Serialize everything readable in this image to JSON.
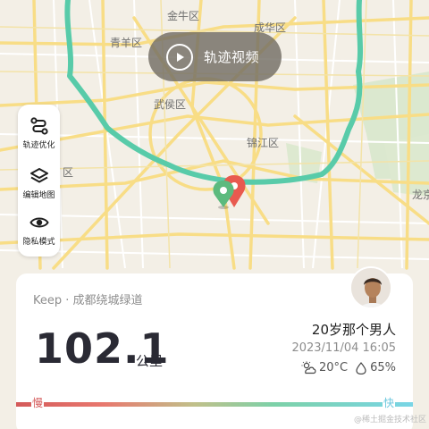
{
  "map": {
    "districts": {
      "jinniu": "金牛区",
      "chenghua": "成华区",
      "qingyang": "青羊区",
      "wuhou": "武侯区",
      "jinjiang": "锦江区",
      "shuangliu_partial": "区",
      "longquan_partial": "龙京"
    },
    "route_color": "#58cba9",
    "start_marker_color": "#5cba7e",
    "end_marker_color": "#e85a4f"
  },
  "video_button": {
    "label": "轨迹视频",
    "icon": "play-icon"
  },
  "toolbox": {
    "items": [
      {
        "label": "轨迹优化",
        "icon": "route-optimize-icon"
      },
      {
        "label": "编辑地图",
        "icon": "layers-icon"
      },
      {
        "label": "隐私模式",
        "icon": "eye-icon"
      }
    ]
  },
  "card": {
    "route_title": "Keep · 成都绕城绿道",
    "distance": "102.1",
    "unit": "公里",
    "username": "20岁那个男人",
    "datetime": "2023/11/04 16:05",
    "temperature": "20°C",
    "humidity": "65%",
    "weather_icon": "partly-cloudy-icon",
    "humidity_icon": "water-drop-icon",
    "speed_slow": "慢",
    "speed_fast": "快"
  },
  "watermark": "@稀土掘金技术社区"
}
